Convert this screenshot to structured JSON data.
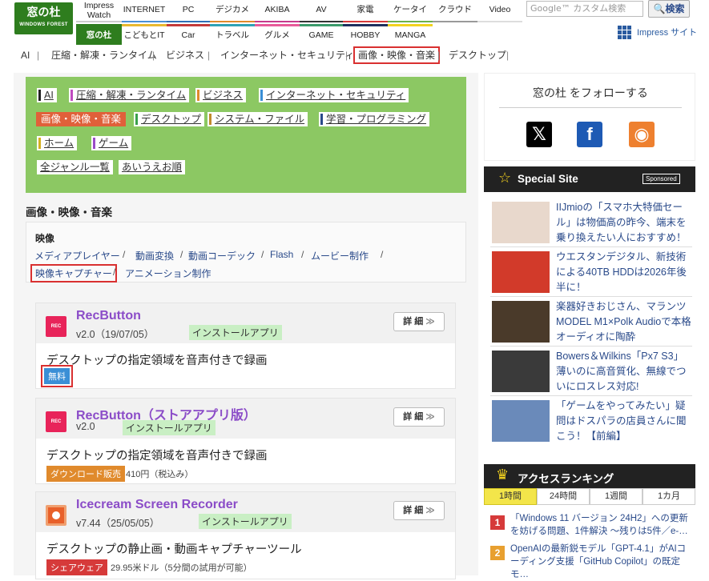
{
  "logo": {
    "main": "窓の杜",
    "sub": "WINDOWS FOREST"
  },
  "top_nav": {
    "row1": [
      {
        "label": "Impress\nWatch",
        "color": "#cccccc"
      },
      {
        "label": "INTERNET",
        "color": "#4a8fd6"
      },
      {
        "label": "PC",
        "color": "#2e6fb6"
      },
      {
        "label": "デジカメ",
        "color": "#e08a2c"
      },
      {
        "label": "AKIBA",
        "color": "#c63a8d"
      },
      {
        "label": "AV",
        "color": "#333333"
      },
      {
        "label": "家電",
        "color": "#d63a3a"
      },
      {
        "label": "ケータイ",
        "color": "#6ab04c"
      },
      {
        "label": "クラウド",
        "color": "#999999"
      },
      {
        "label": "Video",
        "color": "#dddddd"
      }
    ],
    "row2": [
      {
        "label": "窓の杜",
        "color": "#2e7d1e"
      },
      {
        "label": "こどもとIT",
        "color": "#e8b830"
      },
      {
        "label": "Car",
        "color": "#c43a3a"
      },
      {
        "label": "トラベル",
        "color": "#2ea3b6"
      },
      {
        "label": "グルメ",
        "color": "#e85a9a"
      },
      {
        "label": "GAME",
        "color": "#3a9a6a"
      },
      {
        "label": "HOBBY",
        "color": "#1e2f5e"
      },
      {
        "label": "MANGA",
        "color": "#f2d21e"
      }
    ],
    "search_placeholder": "Google™ カスタム検索",
    "search_button": "🔍検索",
    "impress_site": "Impress サイト"
  },
  "sub_nav": [
    "AI",
    "圧縮・解凍・ランタイム",
    "ビジネス",
    "インターネット・セキュリティ",
    "画像・映像・音楽",
    "デスクトップ"
  ],
  "genres": [
    {
      "label": "AI",
      "color": "#222222"
    },
    {
      "label": "圧縮・解凍・ランタイム",
      "color": "#c04cc0"
    },
    {
      "label": "ビジネス",
      "color": "#e08a2c"
    },
    {
      "label": "インターネット・セキュリティ",
      "color": "#3a8fd6"
    },
    {
      "label": "画像・映像・音楽",
      "color": "#e0603a"
    },
    {
      "label": "デスクトップ",
      "color": "#3aa04c"
    },
    {
      "label": "システム・ファイル",
      "color": "#c08a2c"
    },
    {
      "label": "学習・プログラミング",
      "color": "#2a4a8a"
    },
    {
      "label": "ホーム",
      "color": "#d4b020"
    },
    {
      "label": "ゲーム",
      "color": "#9a4cc8"
    },
    {
      "label": "全ジャンル一覧",
      "color": ""
    },
    {
      "label": "あいうえお順",
      "color": ""
    }
  ],
  "category_title": "画像・映像・音楽",
  "subcategory": {
    "heading": "映像",
    "links": [
      "メディアプレイヤー",
      "動画変換",
      "動画コーデック",
      "Flash",
      "ムービー制作",
      "映像キャプチャー",
      "アニメーション制作"
    ],
    "separator": "/"
  },
  "apps": [
    {
      "name": "RecButton",
      "version": "v2.0（19/07/05）",
      "type": "インストールアプリ",
      "desc": "デスクトップの指定領域を音声付きで録画",
      "badge": "無料",
      "badge_color": "#3a8fd6",
      "price": "",
      "icon_text": "REC",
      "icon_color": "#e8245a",
      "detail": "詳 細"
    },
    {
      "name": "RecButton（ストアアプリ版）",
      "version": "v2.0",
      "type": "インストールアプリ",
      "desc": "デスクトップの指定領域を音声付きで録画",
      "badge": "ダウンロード販売",
      "badge_color": "#e08a2c",
      "price": "410円（税込み）",
      "icon_text": "REC",
      "icon_color": "#e8245a",
      "detail": "詳 細"
    },
    {
      "name": "Icecream Screen Recorder",
      "version": "v7.44（25/05/05）",
      "type": "インストールアプリ",
      "desc": "デスクトップの静止画・動画キャプチャーツール",
      "badge": "シェアウェア",
      "badge_color": "#d63a3a",
      "price": "29.95米ドル（5分間の試用が可能）",
      "icon_text": "",
      "icon_color": "#e8602a",
      "detail": "詳 細"
    }
  ],
  "follow": {
    "title": "窓の杜 をフォローする",
    "icons": [
      {
        "name": "x",
        "glyph": "𝕏",
        "color": "#000000"
      },
      {
        "name": "facebook",
        "glyph": "f",
        "color": "#1e5ab4"
      },
      {
        "name": "rss",
        "glyph": "◉",
        "color": "#ee802f"
      }
    ]
  },
  "special": {
    "title": "Special Site",
    "sponsored": "Sponsored",
    "items": [
      {
        "text": "IIJmioの「スマホ大特価セール」は物価高の昨今、端末を乗り換えたい人におすすめ！",
        "thumb_color": "#e8d8cc"
      },
      {
        "text": "ウエスタンデジタル、新技術による40TB HDDは2026年後半に！",
        "thumb_color": "#d23a2a"
      },
      {
        "text": "楽器好きおじさん、マランツMODEL M1×Polk Audioで本格オーディオに陶酔",
        "thumb_color": "#4a3a2a"
      },
      {
        "text": "Bowers＆Wilkins「Px7 S3」薄いのに高音質化、無線でついにロスレス対応!",
        "thumb_color": "#3a3a3a"
      },
      {
        "text": "「ゲームをやってみたい」疑問はドスパラの店員さんに聞こう！【前編】",
        "thumb_color": "#6a8aba"
      }
    ]
  },
  "ranking": {
    "title": "アクセスランキング",
    "tabs": [
      "1時間",
      "24時間",
      "1週間",
      "1カ月"
    ],
    "active_tab": "1時間",
    "items": [
      {
        "num": "1",
        "text": "「Windows 11 バージョン 24H2」への更新を妨げる問題、1件解決 ～残りは5件／e-…",
        "color": "#d63a3a"
      },
      {
        "num": "2",
        "text": "OpenAIの最新鋭モデル「GPT-4.1」がAIコーディング支援「GitHub Copilot」の既定モ…",
        "color": "#e8a030"
      }
    ]
  }
}
